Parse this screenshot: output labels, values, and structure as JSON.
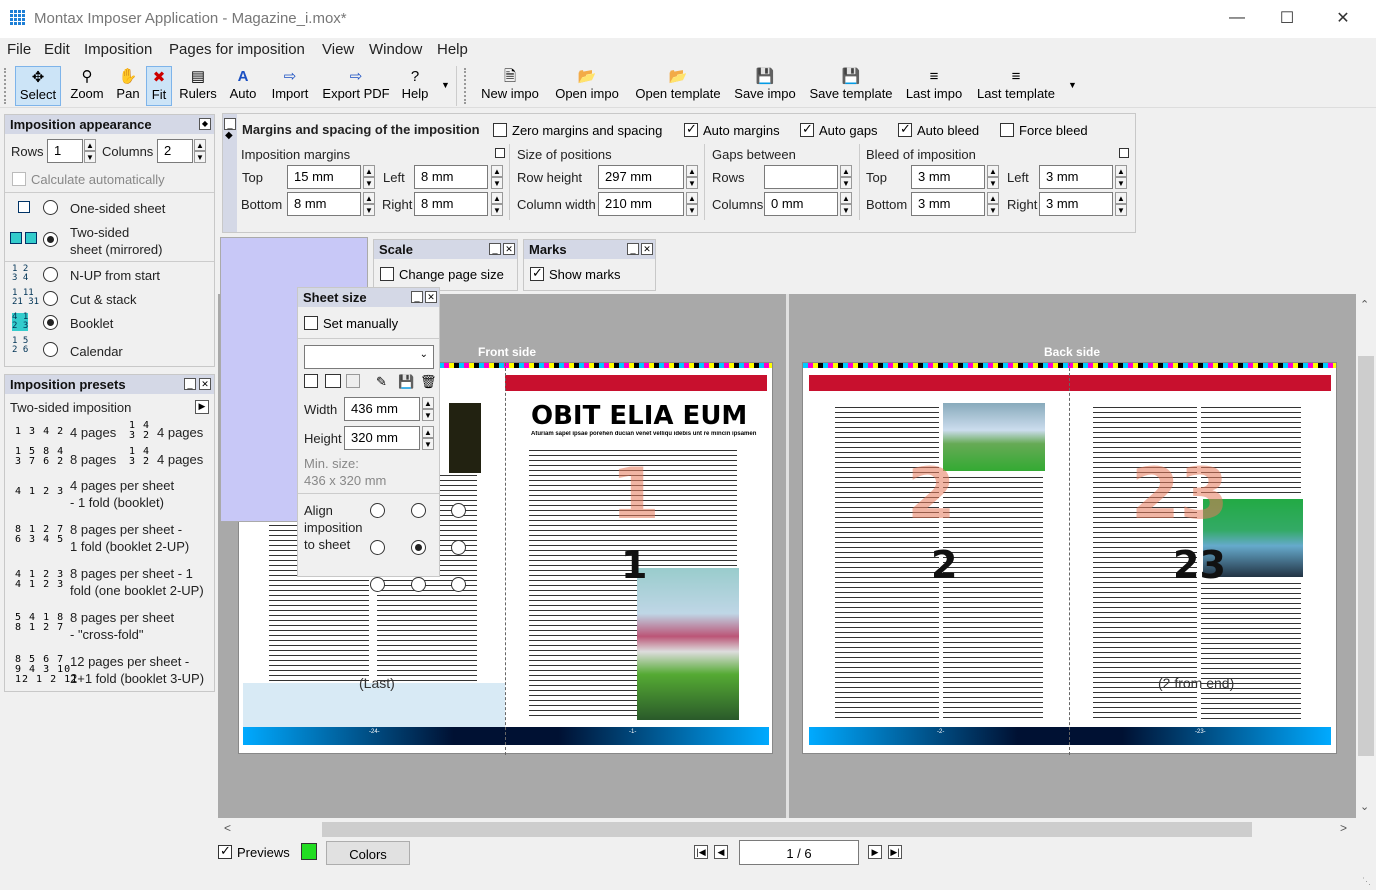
{
  "window": {
    "title": "Montax Imposer Application - Magazine_i.mox*"
  },
  "menu": [
    "File",
    "Edit",
    "Imposition",
    "Pages for imposition",
    "View",
    "Window",
    "Help"
  ],
  "toolbar_left": [
    {
      "label": "Select",
      "icon": "move-icon"
    },
    {
      "label": "Zoom",
      "icon": "zoom-icon"
    },
    {
      "label": "Pan",
      "icon": "hand-icon"
    },
    {
      "label": "Fit",
      "icon": "fit-icon"
    },
    {
      "label": "Rulers",
      "icon": "rulers-icon"
    },
    {
      "label": "Auto",
      "icon": "auto-icon"
    },
    {
      "label": "Import",
      "icon": "import-icon"
    },
    {
      "label": "Export PDF",
      "icon": "export-icon"
    },
    {
      "label": "Help",
      "icon": "help-icon"
    }
  ],
  "toolbar_right": [
    {
      "label": "New impo",
      "icon": "new-icon"
    },
    {
      "label": "Open impo",
      "icon": "open-icon"
    },
    {
      "label": "Open template",
      "icon": "open-template-icon"
    },
    {
      "label": "Save impo",
      "icon": "save-icon"
    },
    {
      "label": "Save template",
      "icon": "save-template-icon"
    },
    {
      "label": "Last impo",
      "icon": "last-icon"
    },
    {
      "label": "Last template",
      "icon": "last-template-icon"
    }
  ],
  "appearance": {
    "title": "Imposition appearance",
    "rows_label": "Rows",
    "rows_value": "1",
    "columns_label": "Columns",
    "columns_value": "2",
    "calc_auto": "Calculate automatically",
    "options": [
      {
        "label": "One-sided sheet",
        "selected": false
      },
      {
        "label": "Two-sided",
        "label2": "sheet (mirrored)",
        "selected": true
      },
      {
        "label": "N-UP from start",
        "selected": false
      },
      {
        "label": "Cut & stack",
        "selected": false
      },
      {
        "label": "Booklet",
        "selected": true
      },
      {
        "label": "Calendar",
        "selected": false
      }
    ]
  },
  "presets": {
    "title": "Imposition presets",
    "selected": "Two-sided imposition",
    "items": [
      {
        "a": "4 pages",
        "b": "4 pages"
      },
      {
        "a": "8 pages",
        "b": "4 pages"
      },
      {
        "a": "4 pages per sheet",
        "b": "- 1 fold (booklet)"
      },
      {
        "a": "8 pages per sheet -",
        "b": "1 fold (booklet 2-UP)"
      },
      {
        "a": "8 pages per sheet - 1",
        "b": "fold (one booklet 2-UP)"
      },
      {
        "a": "8 pages per sheet",
        "b": "- \"cross-fold\""
      },
      {
        "a": "12 pages per sheet -",
        "b": "2+1 fold (booklet 3-UP)"
      }
    ]
  },
  "margins": {
    "title": "Margins and spacing of the imposition",
    "zero": "Zero margins and spacing",
    "auto_margins": "Auto margins",
    "auto_gaps": "Auto gaps",
    "auto_bleed": "Auto bleed",
    "force_bleed": "Force bleed",
    "imposition_margins": "Imposition margins",
    "top_label": "Top",
    "top": "15 mm",
    "left_label": "Left",
    "left": "8 mm",
    "bottom_label": "Bottom",
    "bottom": "8 mm",
    "right_label": "Right",
    "right": "8 mm",
    "size_positions": "Size of positions",
    "row_height_label": "Row height",
    "row_height": "297 mm",
    "col_width_label": "Column width",
    "col_width": "210 mm",
    "gaps_between": "Gaps between",
    "gap_rows_label": "Rows",
    "gap_rows": "",
    "gap_cols_label": "Columns",
    "gap_cols": "0 mm",
    "bleed": "Bleed of imposition",
    "b_top_label": "Top",
    "b_top": "3 mm",
    "b_left_label": "Left",
    "b_left": "3 mm",
    "b_bottom_label": "Bottom",
    "b_bottom": "3 mm",
    "b_right_label": "Right",
    "b_right": "3 mm"
  },
  "scale": {
    "title": "Scale",
    "change": "Change page size"
  },
  "marks": {
    "title": "Marks",
    "show": "Show marks"
  },
  "sheet_size": {
    "title": "Sheet size",
    "set_manually": "Set manually",
    "width_label": "Width",
    "width": "436 mm",
    "height_label": "Height",
    "height": "320 mm",
    "min_label": "Min. size:",
    "min_value": "436 x 320 mm",
    "align_label": "Align imposition to sheet"
  },
  "preview": {
    "front": "Front side",
    "back": "Back side",
    "headline": "OBIT ELIA EUM",
    "subhead": "Aturiam sapel ipsae porehen ducian venet velliqu idebis unt re mincin ipsamen",
    "front_pages": [
      "1",
      "1"
    ],
    "back_pages": [
      "2",
      "23"
    ],
    "ghost_front": "1",
    "ghost_back_left": "2",
    "ghost_back_right": "23",
    "last_label": "(Last)",
    "from_end_label": "(2 from end)",
    "footer_front_left": "-24-",
    "footer_front_right": "-1-",
    "footer_back_left": "-2-",
    "footer_back_right": "-23-"
  },
  "bottom": {
    "previews": "Previews",
    "colors": "Colors",
    "page": "1 / 6"
  }
}
